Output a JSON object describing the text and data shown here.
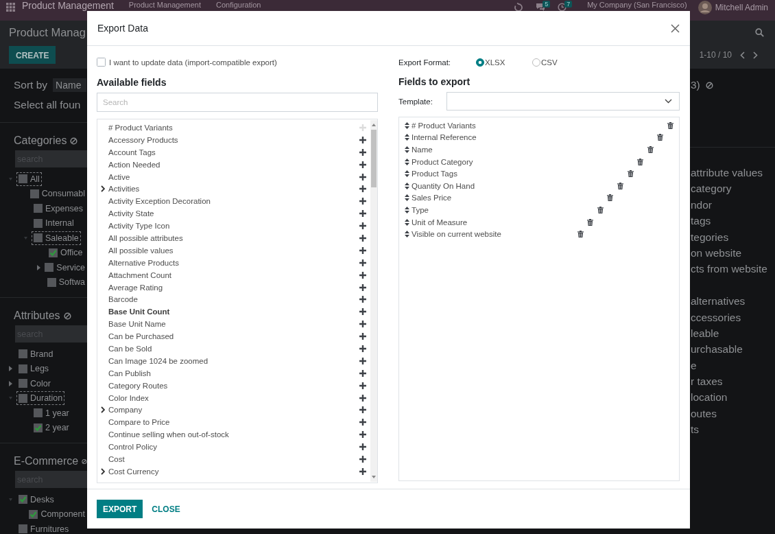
{
  "navbar": {
    "app_name": "Product Management",
    "menus": [
      "Product Management",
      "Configuration"
    ],
    "chat_count": "5",
    "activity_count": "7",
    "company": "My Company (San Francisco)",
    "user": "Mitchell Admin"
  },
  "control_panel": {
    "title": "Product Manag",
    "create": "CREATE",
    "pager": "1-10 / 10"
  },
  "sidebar": {
    "sort_label": "Sort by",
    "sort_value": "Name",
    "select_all": "Select all foun",
    "sections": [
      {
        "title": "Categories",
        "search_placeholder": "search",
        "items": [
          {
            "label": "All",
            "checked": false,
            "focused": true,
            "expanded": true,
            "children": [
              {
                "label": "Consumabl",
                "checked": false,
                "focused": false,
                "expanded": false
              },
              {
                "label": "Expenses",
                "checked": false,
                "focused": false,
                "expanded": false
              },
              {
                "label": "Internal",
                "checked": false,
                "focused": false,
                "expanded": false
              },
              {
                "label": "Saleable",
                "checked": false,
                "focused": true,
                "expanded": true,
                "children": [
                  {
                    "label": "Office",
                    "checked": true,
                    "focused": false,
                    "expanded": false
                  },
                  {
                    "label": "Service",
                    "checked": false,
                    "focused": false,
                    "expanded": false,
                    "collapsed_caret": true
                  },
                  {
                    "label": "Softwa",
                    "checked": false,
                    "focused": false,
                    "expanded": false
                  }
                ]
              }
            ]
          }
        ]
      },
      {
        "title": "Attributes",
        "search_placeholder": "search",
        "items": [
          {
            "label": "Brand",
            "checked": false,
            "focused": false,
            "expanded": false
          },
          {
            "label": "Legs",
            "checked": false,
            "focused": false,
            "expanded": false,
            "collapsed_caret": true
          },
          {
            "label": "Color",
            "checked": false,
            "focused": false,
            "expanded": false,
            "collapsed_caret": true
          },
          {
            "label": "Duration",
            "checked": false,
            "focused": true,
            "expanded": true,
            "children": [
              {
                "label": "1 year",
                "checked": false,
                "focused": false,
                "expanded": false
              },
              {
                "label": "2 year",
                "checked": true,
                "focused": false,
                "expanded": false
              }
            ]
          }
        ]
      },
      {
        "title": "E-Commerce",
        "search_placeholder": "search",
        "items": [
          {
            "label": "Desks",
            "checked": true,
            "focused": false,
            "expanded": true,
            "children": [
              {
                "label": "Component",
                "checked": true,
                "focused": false,
                "expanded": false
              }
            ]
          },
          {
            "label": "Furnitures",
            "checked": false,
            "focused": false,
            "expanded": false
          }
        ]
      }
    ]
  },
  "right_panel": {
    "heading": "3)",
    "groups": [
      [
        "attribute values",
        "category",
        "ndor",
        "tags",
        "tegories",
        "on website",
        "cts from website"
      ],
      [
        "alternatives",
        "ccessories",
        "leable",
        "urchasable",
        "e",
        "r taxes",
        "location",
        "outes",
        "ts"
      ]
    ]
  },
  "dialog": {
    "title": "Export Data",
    "import_compatible": {
      "label": "I want to update data (import-compatible export)",
      "checked": false
    },
    "available_title": "Available fields",
    "search_placeholder": "Search",
    "available_fields": [
      {
        "label": "# Product Variants",
        "expandable": false,
        "required": false,
        "added": true
      },
      {
        "label": "Accessory Products",
        "expandable": false,
        "required": false,
        "added": false
      },
      {
        "label": "Account Tags",
        "expandable": false,
        "required": false,
        "added": false
      },
      {
        "label": "Action Needed",
        "expandable": false,
        "required": false,
        "added": false
      },
      {
        "label": "Active",
        "expandable": false,
        "required": false,
        "added": false
      },
      {
        "label": "Activities",
        "expandable": true,
        "required": false,
        "added": false
      },
      {
        "label": "Activity Exception Decoration",
        "expandable": false,
        "required": false,
        "added": false
      },
      {
        "label": "Activity State",
        "expandable": false,
        "required": false,
        "added": false
      },
      {
        "label": "Activity Type Icon",
        "expandable": false,
        "required": false,
        "added": false
      },
      {
        "label": "All possible attributes",
        "expandable": false,
        "required": false,
        "added": false
      },
      {
        "label": "All possible values",
        "expandable": false,
        "required": false,
        "added": false
      },
      {
        "label": "Alternative Products",
        "expandable": false,
        "required": false,
        "added": false
      },
      {
        "label": "Attachment Count",
        "expandable": false,
        "required": false,
        "added": false
      },
      {
        "label": "Average Rating",
        "expandable": false,
        "required": false,
        "added": false
      },
      {
        "label": "Barcode",
        "expandable": false,
        "required": false,
        "added": false
      },
      {
        "label": "Base Unit Count",
        "expandable": false,
        "required": true,
        "added": false
      },
      {
        "label": "Base Unit Name",
        "expandable": false,
        "required": false,
        "added": false
      },
      {
        "label": "Can be Purchased",
        "expandable": false,
        "required": false,
        "added": false
      },
      {
        "label": "Can be Sold",
        "expandable": false,
        "required": false,
        "added": false
      },
      {
        "label": "Can Image 1024 be zoomed",
        "expandable": false,
        "required": false,
        "added": false
      },
      {
        "label": "Can Publish",
        "expandable": false,
        "required": false,
        "added": false
      },
      {
        "label": "Category Routes",
        "expandable": false,
        "required": false,
        "added": false
      },
      {
        "label": "Color Index",
        "expandable": false,
        "required": false,
        "added": false
      },
      {
        "label": "Company",
        "expandable": true,
        "required": false,
        "added": false
      },
      {
        "label": "Compare to Price",
        "expandable": false,
        "required": false,
        "added": false
      },
      {
        "label": "Continue selling when out-of-stock",
        "expandable": false,
        "required": false,
        "added": false
      },
      {
        "label": "Control Policy",
        "expandable": false,
        "required": false,
        "added": false
      },
      {
        "label": "Cost",
        "expandable": false,
        "required": false,
        "added": false
      },
      {
        "label": "Cost Currency",
        "expandable": true,
        "required": false,
        "added": false
      }
    ],
    "format_label": "Export Format:",
    "formats": [
      {
        "label": "XLSX",
        "selected": true
      },
      {
        "label": "CSV",
        "selected": false
      }
    ],
    "export_title": "Fields to export",
    "template_label": "Template:",
    "export_fields": [
      "# Product Variants",
      "Internal Reference",
      "Name",
      "Product Category",
      "Product Tags",
      "Quantity On Hand",
      "Sales Price",
      "Type",
      "Unit of Measure",
      "Visible on current website"
    ],
    "buttons": {
      "export": "EXPORT",
      "close": "CLOSE"
    }
  }
}
